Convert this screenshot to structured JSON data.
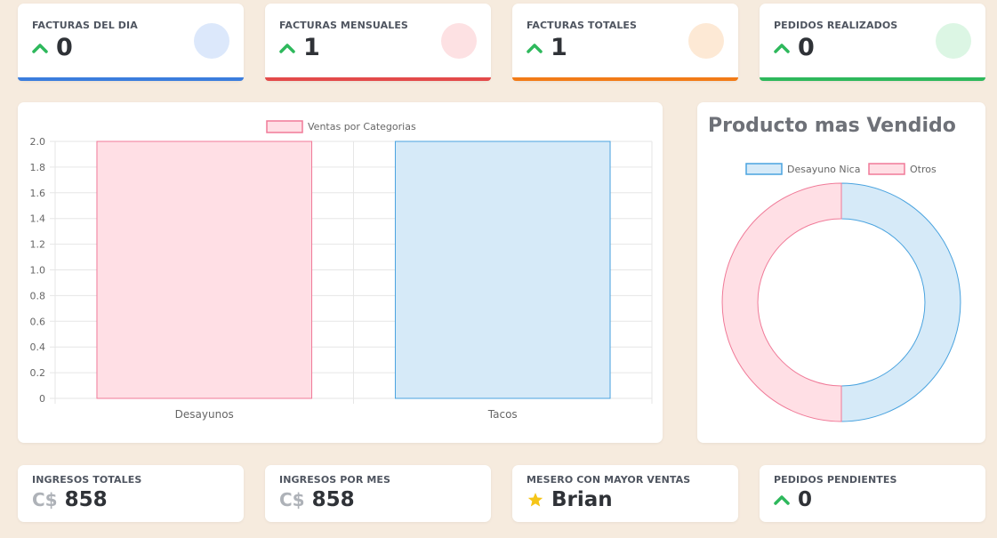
{
  "top_stats": [
    {
      "title": "FACTURAS DEL DIA",
      "value": "0",
      "accent": "#3b7ddd",
      "circle": "#dce8fb"
    },
    {
      "title": "FACTURAS MENSUALES",
      "value": "1",
      "accent": "#e34a4a",
      "circle": "#fde1e3"
    },
    {
      "title": "FACTURAS TOTALES",
      "value": "1",
      "accent": "#f27b17",
      "circle": "#fde9d5"
    },
    {
      "title": "PEDIDOS REALIZADOS",
      "value": "0",
      "accent": "#2eb85c",
      "circle": "#dcf6e4"
    }
  ],
  "bottom_stats": [
    {
      "title": "INGRESOS TOTALES",
      "prefix": "C$",
      "value": "858"
    },
    {
      "title": "INGRESOS POR MES",
      "prefix": "C$",
      "value": "858"
    },
    {
      "title": "MESERO CON MAYOR VENTAS",
      "value": "Brian"
    },
    {
      "title": "PEDIDOS PENDIENTES",
      "value": "0"
    }
  ],
  "colors": {
    "up_arrow": "#2eb85c",
    "star": "#f5c518",
    "pink_fill": "#ffdfe5",
    "pink_line": "#f07a98",
    "blue_fill": "#d6eaf8",
    "blue_line": "#4aa3df"
  },
  "chart_data": [
    {
      "type": "bar",
      "categories": [
        "Desayunos",
        "Tacos"
      ],
      "series": [
        {
          "name": "Ventas por Categorias",
          "values": [
            2,
            2
          ]
        }
      ],
      "ylim": [
        0,
        2
      ],
      "yticks": [
        "2.0",
        "1.8",
        "1.6",
        "1.4",
        "1.2",
        "1.0",
        "0.8",
        "0.6",
        "0.4",
        "0.2",
        "0"
      ],
      "legend": "top-center",
      "grid": true
    },
    {
      "type": "pie",
      "title": "Producto mas Vendido",
      "labels": [
        "Desayuno Nica",
        "Otros"
      ],
      "values": [
        50,
        50
      ],
      "legend": "top-center"
    }
  ]
}
